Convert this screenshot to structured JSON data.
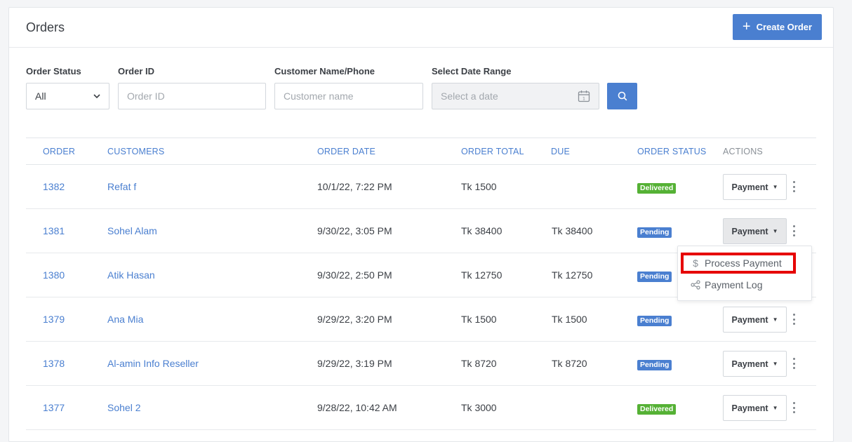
{
  "header": {
    "title": "Orders",
    "create_label": "Create Order"
  },
  "filters": {
    "status_label": "Order Status",
    "status_value": "All",
    "order_id_label": "Order ID",
    "order_id_placeholder": "Order ID",
    "customer_label": "Customer Name/Phone",
    "customer_placeholder": "Customer name",
    "date_label": "Select Date Range",
    "date_placeholder": "Select a date"
  },
  "table": {
    "columns": {
      "order": "ORDER",
      "customers": "CUSTOMERS",
      "order_date": "ORDER DATE",
      "order_total": "ORDER TOTAL",
      "due": "DUE",
      "order_status": "ORDER STATUS",
      "actions": "ACTIONS"
    },
    "payment_label": "Payment",
    "rows": [
      {
        "order": "1382",
        "customer": "Refat f",
        "date": "10/1/22, 7:22 PM",
        "total": "Tk 1500",
        "due": "",
        "status": "Delivered"
      },
      {
        "order": "1381",
        "customer": "Sohel Alam",
        "date": "9/30/22, 3:05 PM",
        "total": "Tk 38400",
        "due": "Tk 38400",
        "status": "Pending"
      },
      {
        "order": "1380",
        "customer": "Atik Hasan",
        "date": "9/30/22, 2:50 PM",
        "total": "Tk 12750",
        "due": "Tk 12750",
        "status": "Pending"
      },
      {
        "order": "1379",
        "customer": "Ana Mia",
        "date": "9/29/22, 3:20 PM",
        "total": "Tk 1500",
        "due": "Tk 1500",
        "status": "Pending"
      },
      {
        "order": "1378",
        "customer": "Al-amin Info Reseller",
        "date": "9/29/22, 3:19 PM",
        "total": "Tk 8720",
        "due": "Tk 8720",
        "status": "Pending"
      },
      {
        "order": "1377",
        "customer": "Sohel 2",
        "date": "9/28/22, 10:42 AM",
        "total": "Tk 3000",
        "due": "",
        "status": "Delivered"
      }
    ]
  },
  "dropdown": {
    "process_payment": "Process Payment",
    "payment_log": "Payment Log"
  },
  "colors": {
    "accent": "#4a7fd0",
    "delivered": "#55b135",
    "pending": "#4a7fd0",
    "highlight": "#e60000"
  }
}
